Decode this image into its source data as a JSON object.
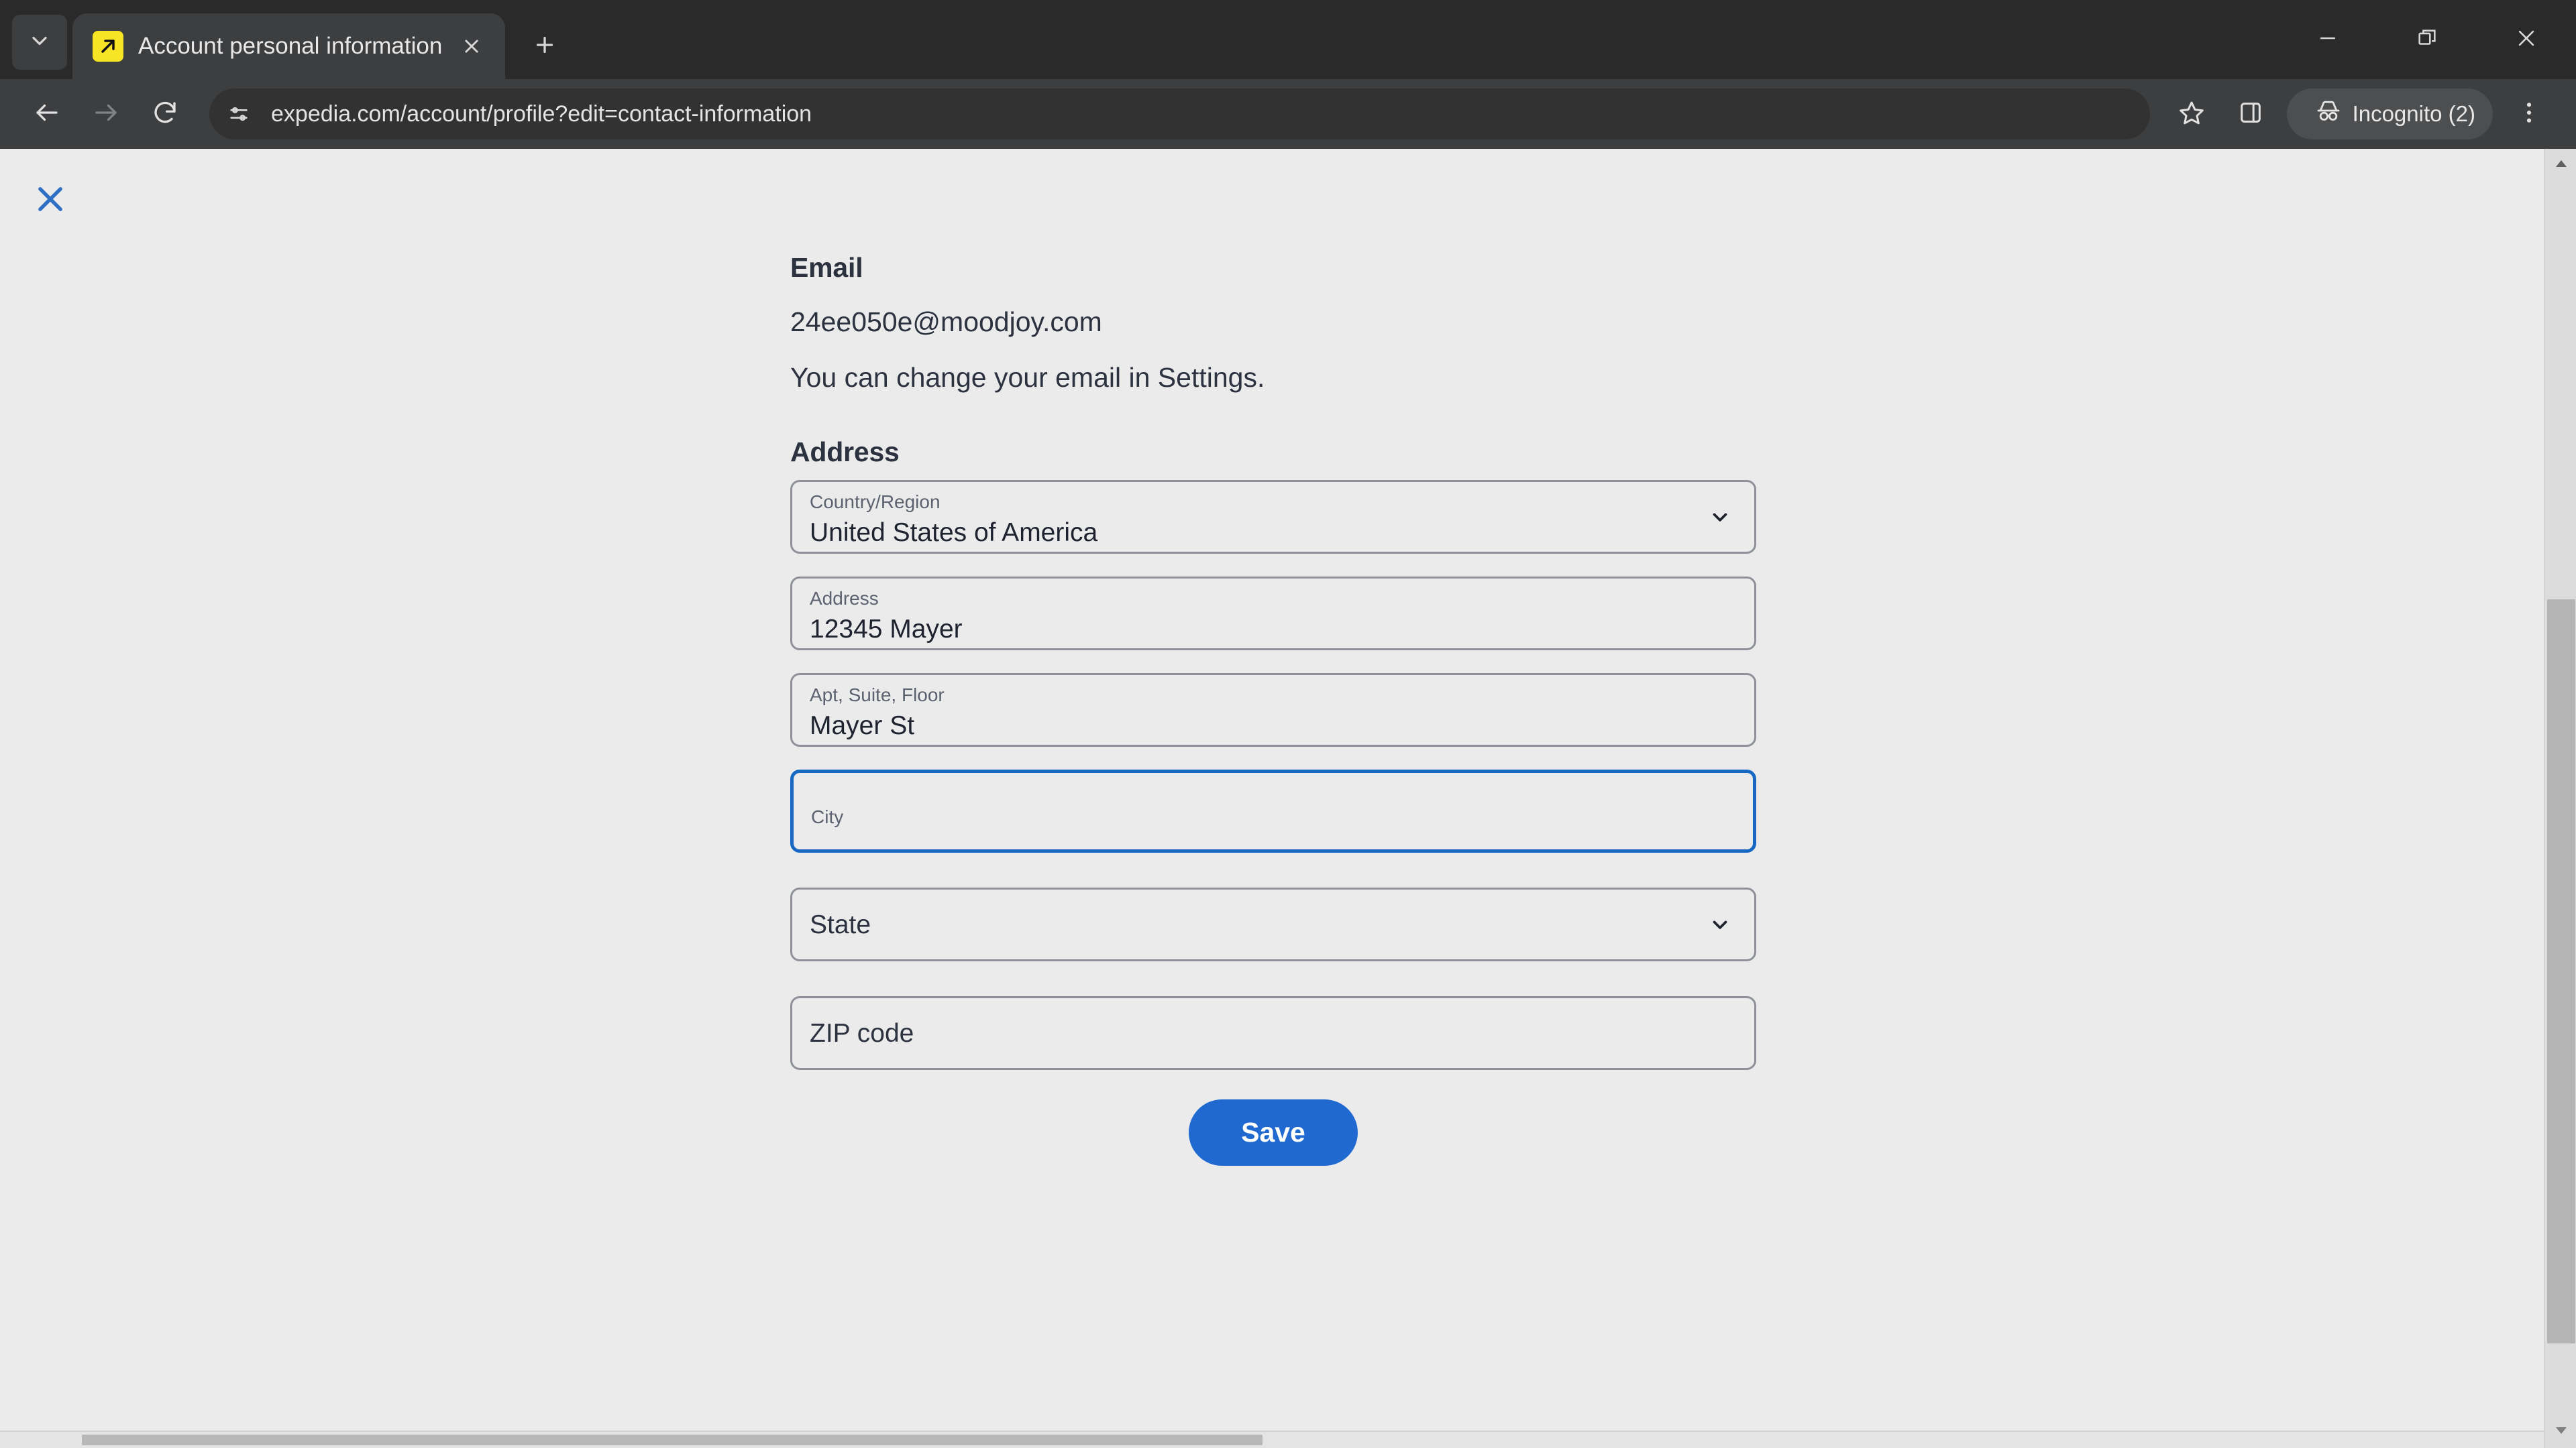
{
  "browser": {
    "tab_search_icon": "chevron-down-icon",
    "tab": {
      "title": "Account personal information",
      "favicon": "expedia-favicon",
      "close_icon": "close-icon"
    },
    "new_tab_icon": "plus-icon",
    "window_controls": {
      "minimize": "minimize-icon",
      "restore": "restore-icon",
      "close": "close-icon"
    },
    "toolbar": {
      "back_icon": "arrow-left-icon",
      "forward_icon": "arrow-right-icon",
      "reload_icon": "reload-icon",
      "page_info_icon": "page-settings-icon",
      "url": "expedia.com/account/profile?edit=contact-information",
      "bookmark_icon": "star-icon",
      "side_panel_icon": "side-panel-icon",
      "incognito_label": "Incognito (2)",
      "incognito_icon": "incognito-icon",
      "menu_icon": "three-dot-menu-icon"
    },
    "colors": {
      "chrome_bg": "#3d3e40",
      "tabstrip_bg": "#2a2a2a",
      "omnibox_bg": "#323232"
    }
  },
  "page": {
    "close_icon": "close-icon",
    "accent": "#1f69d0",
    "focus_border": "#1668c2",
    "background": "#ebebeb",
    "email_section": {
      "heading": "Email",
      "value": "24ee050e@moodjoy.com",
      "note": "You can change your email in Settings."
    },
    "address_section": {
      "heading": "Address",
      "fields": [
        {
          "name": "country-region",
          "label": "Country/Region",
          "value": "United States of America",
          "type": "select",
          "focused": false,
          "chevron_icon": "chevron-down-icon"
        },
        {
          "name": "address",
          "label": "Address",
          "value": "12345 Mayer",
          "type": "text",
          "focused": false
        },
        {
          "name": "apt-suite-floor",
          "label": "Apt, Suite, Floor",
          "value": "Mayer St",
          "type": "text",
          "focused": false
        },
        {
          "name": "city",
          "label": "City",
          "value": "",
          "placeholder": "City",
          "type": "text",
          "focused": true
        },
        {
          "name": "state",
          "label": "",
          "value": "",
          "placeholder": "State",
          "type": "select",
          "focused": false,
          "chevron_icon": "chevron-down-icon"
        },
        {
          "name": "zip-code",
          "label": "",
          "value": "",
          "placeholder": "ZIP code",
          "type": "text",
          "focused": false
        }
      ]
    },
    "save_label": "Save"
  }
}
